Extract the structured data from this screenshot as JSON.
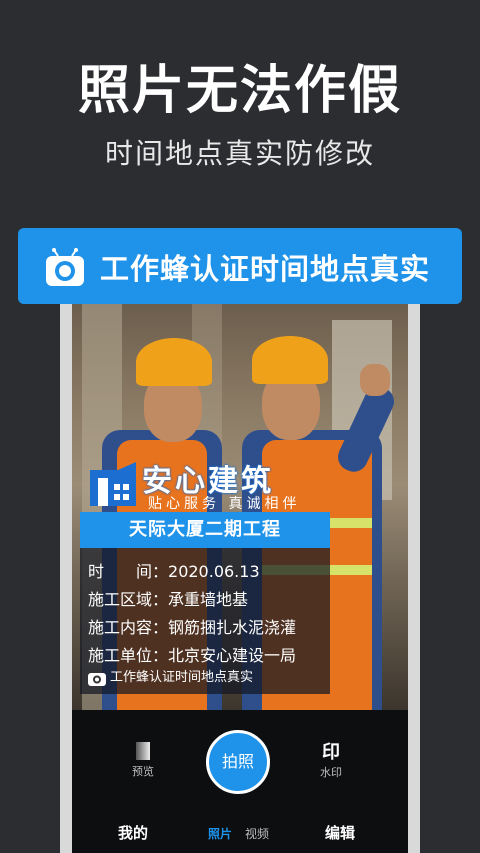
{
  "hero": {
    "headline": "照片无法作假",
    "subline": "时间地点真实防修改"
  },
  "banner": {
    "text": "工作蜂认证时间地点真实",
    "icon": "camera-icon",
    "color": "#1f93ea"
  },
  "watermark": {
    "brand": "安心建筑",
    "slogan": "贴心服务 真诚相伴",
    "project_title": "天际大厦二期工程",
    "rows": [
      {
        "label": "时　　间：",
        "value": "2020.06.13"
      },
      {
        "label": "施工区域：",
        "value": "承重墙地基"
      },
      {
        "label": "施工内容：",
        "value": "钢筋捆扎水泥浇灌"
      },
      {
        "label": "施工单位：",
        "value": "北京安心建设一局"
      }
    ],
    "footer": "工作蜂认证时间地点真实"
  },
  "camera": {
    "preview_label": "预览",
    "shutter_label": "拍照",
    "stamp_glyph": "印",
    "stamp_label": "水印"
  },
  "bottom_nav": {
    "mine": "我的",
    "photo": "照片",
    "video": "视频",
    "edit": "编辑"
  },
  "colors": {
    "background": "#2b2d31",
    "accent": "#1f93ea"
  }
}
